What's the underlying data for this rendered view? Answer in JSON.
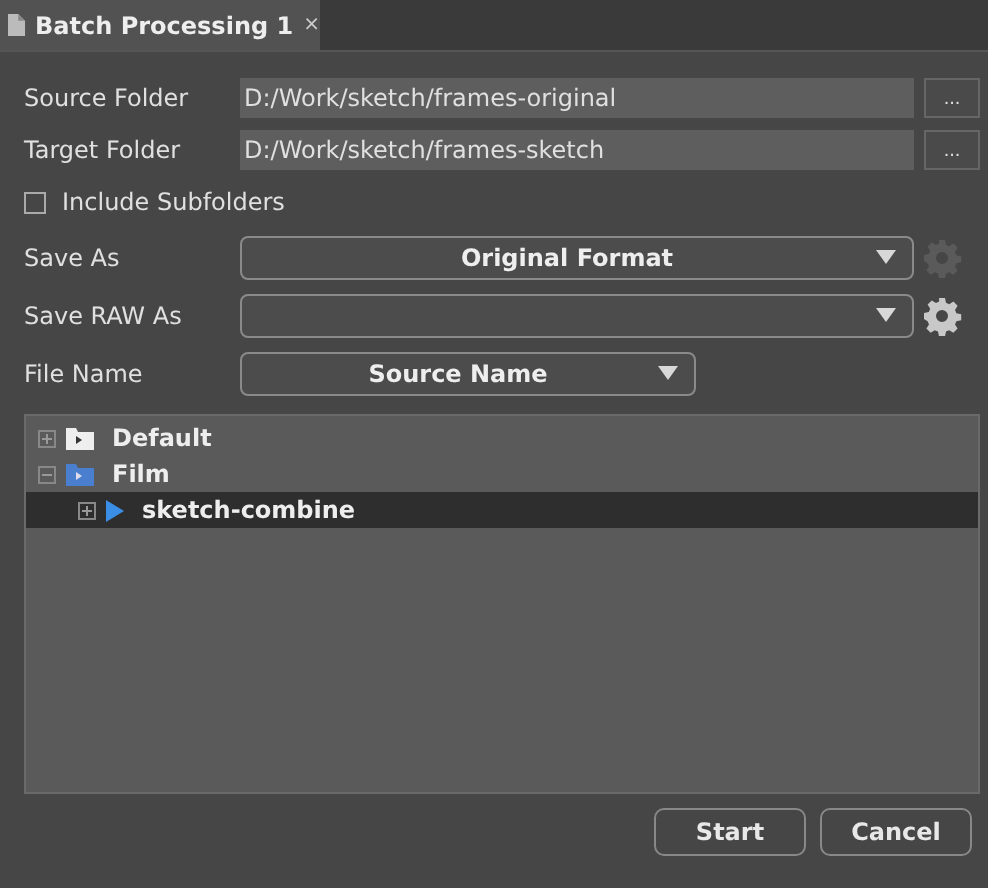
{
  "tab": {
    "title": "Batch Processing 1",
    "close": "×",
    "selected": true
  },
  "folders": [
    {
      "label": "Source Folder",
      "value": "D:/Work/sketch/frames-original",
      "browse": "..."
    },
    {
      "label": "Target Folder",
      "value": "D:/Work/sketch/frames-sketch",
      "browse": "..."
    }
  ],
  "include_subfolders": {
    "label": "Include Subfolders",
    "checked": false
  },
  "save_as": {
    "label": "Save As",
    "value": "Original Format",
    "settings_disabled": true
  },
  "save_raw_as": {
    "label": "Save RAW As",
    "settings_disabled": false
  },
  "file_name": {
    "label": "File Name",
    "value": "Source Name"
  },
  "tree": [
    {
      "label": "Default",
      "kind": "folder",
      "expanded": false,
      "selected": false
    },
    {
      "label": "Film",
      "kind": "folder-blue",
      "expanded": true,
      "selected": false,
      "children": [
        {
          "label": "sketch-combine",
          "kind": "preset",
          "expanded": false,
          "selected": true
        }
      ]
    }
  ],
  "buttons": [
    {
      "label": "Start"
    },
    {
      "label": "Cancel"
    }
  ]
}
